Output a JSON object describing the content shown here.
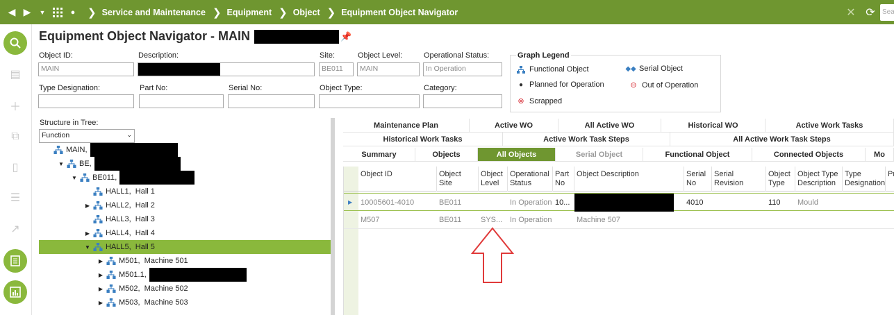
{
  "topbar": {
    "breadcrumbs": [
      "Service and Maintenance",
      "Equipment",
      "Object",
      "Equipment Object Navigator"
    ],
    "search_placeholder": "Sea"
  },
  "page": {
    "title": "Equipment Object Navigator - MAIN"
  },
  "form": {
    "object_id": {
      "label": "Object ID:",
      "value": "MAIN"
    },
    "description": {
      "label": "Description:",
      "value": ""
    },
    "site": {
      "label": "Site:",
      "value": "BE011"
    },
    "object_level": {
      "label": "Object Level:",
      "value": "MAIN"
    },
    "operational_status": {
      "label": "Operational Status:",
      "value": "In Operation"
    },
    "type_designation": {
      "label": "Type Designation:",
      "value": ""
    },
    "part_no": {
      "label": "Part No:",
      "value": ""
    },
    "serial_no": {
      "label": "Serial No:",
      "value": ""
    },
    "object_type": {
      "label": "Object Type:",
      "value": ""
    },
    "category": {
      "label": "Category:",
      "value": ""
    }
  },
  "legend": {
    "title": "Graph Legend",
    "functional": "Functional Object",
    "serial": "Serial Object",
    "planned": "Planned for Operation",
    "out": "Out of Operation",
    "scrapped": "Scrapped",
    "colors": {
      "functional": "#3a7fc1",
      "planned": "#333333",
      "out": "#d9363e",
      "scrapped": "#d9363e"
    }
  },
  "structure": {
    "label": "Structure in Tree:",
    "selected": "Function"
  },
  "tree": [
    {
      "text": "MAIN,",
      "indent": 0,
      "caret": "",
      "selected": false
    },
    {
      "text": "BE,",
      "indent": 1,
      "caret": "down",
      "selected": false
    },
    {
      "text": "BE011,",
      "indent": 2,
      "caret": "down",
      "selected": false
    },
    {
      "text": "HALL1,  Hall 1",
      "indent": 3,
      "caret": "",
      "selected": false
    },
    {
      "text": "HALL2,  Hall 2",
      "indent": 3,
      "caret": "right",
      "selected": false
    },
    {
      "text": "HALL3,  Hall 3",
      "indent": 3,
      "caret": "",
      "selected": false
    },
    {
      "text": "HALL4,  Hall 4",
      "indent": 3,
      "caret": "right",
      "selected": false
    },
    {
      "text": "HALL5,  Hall 5",
      "indent": 3,
      "caret": "down",
      "selected": true
    },
    {
      "text": "M501,  Machine 501",
      "indent": 4,
      "caret": "right",
      "selected": false
    },
    {
      "text": "M501.1,",
      "indent": 4,
      "caret": "right",
      "selected": false
    },
    {
      "text": "M502,  Machine 502",
      "indent": 4,
      "caret": "right",
      "selected": false
    },
    {
      "text": "M503,  Machine 503",
      "indent": 4,
      "caret": "right",
      "selected": false
    }
  ],
  "tabs": {
    "row1": [
      "Maintenance Plan",
      "Active WO",
      "All Active WO",
      "Historical WO",
      "Active Work Tasks"
    ],
    "row2": [
      "Historical Work Tasks",
      "Active Work Task Steps",
      "All Active Work Task Steps"
    ],
    "row3": [
      "Summary",
      "Objects",
      "All Objects",
      "Serial Object",
      "Functional Object",
      "Connected Objects",
      "Mo"
    ]
  },
  "grid": {
    "columns": [
      "Object ID",
      "Object Site",
      "Object Level",
      "Operational Status",
      "Part No",
      "Object Description",
      "Serial No",
      "Serial Revision",
      "Object Type",
      "Object Type Description",
      "Type Designation",
      "Pr"
    ],
    "rows": [
      {
        "object_id": "10005601-4010",
        "site": "BE011",
        "level": "",
        "status": "In Operation",
        "part_no": "10...",
        "description": "",
        "serial_no": "4010",
        "serial_rev": "",
        "type": "110",
        "type_desc": "Mould",
        "type_designation": ""
      },
      {
        "object_id": "M507",
        "site": "BE011",
        "level": "SYS...",
        "status": "In Operation",
        "part_no": "",
        "description": "Machine 507",
        "serial_no": "",
        "serial_rev": "",
        "type": "",
        "type_desc": "",
        "type_designation": ""
      }
    ]
  },
  "colors": {
    "brand": "#6f9630",
    "selection": "#8ab83c",
    "annotation_arrow": "#e03a3a"
  }
}
